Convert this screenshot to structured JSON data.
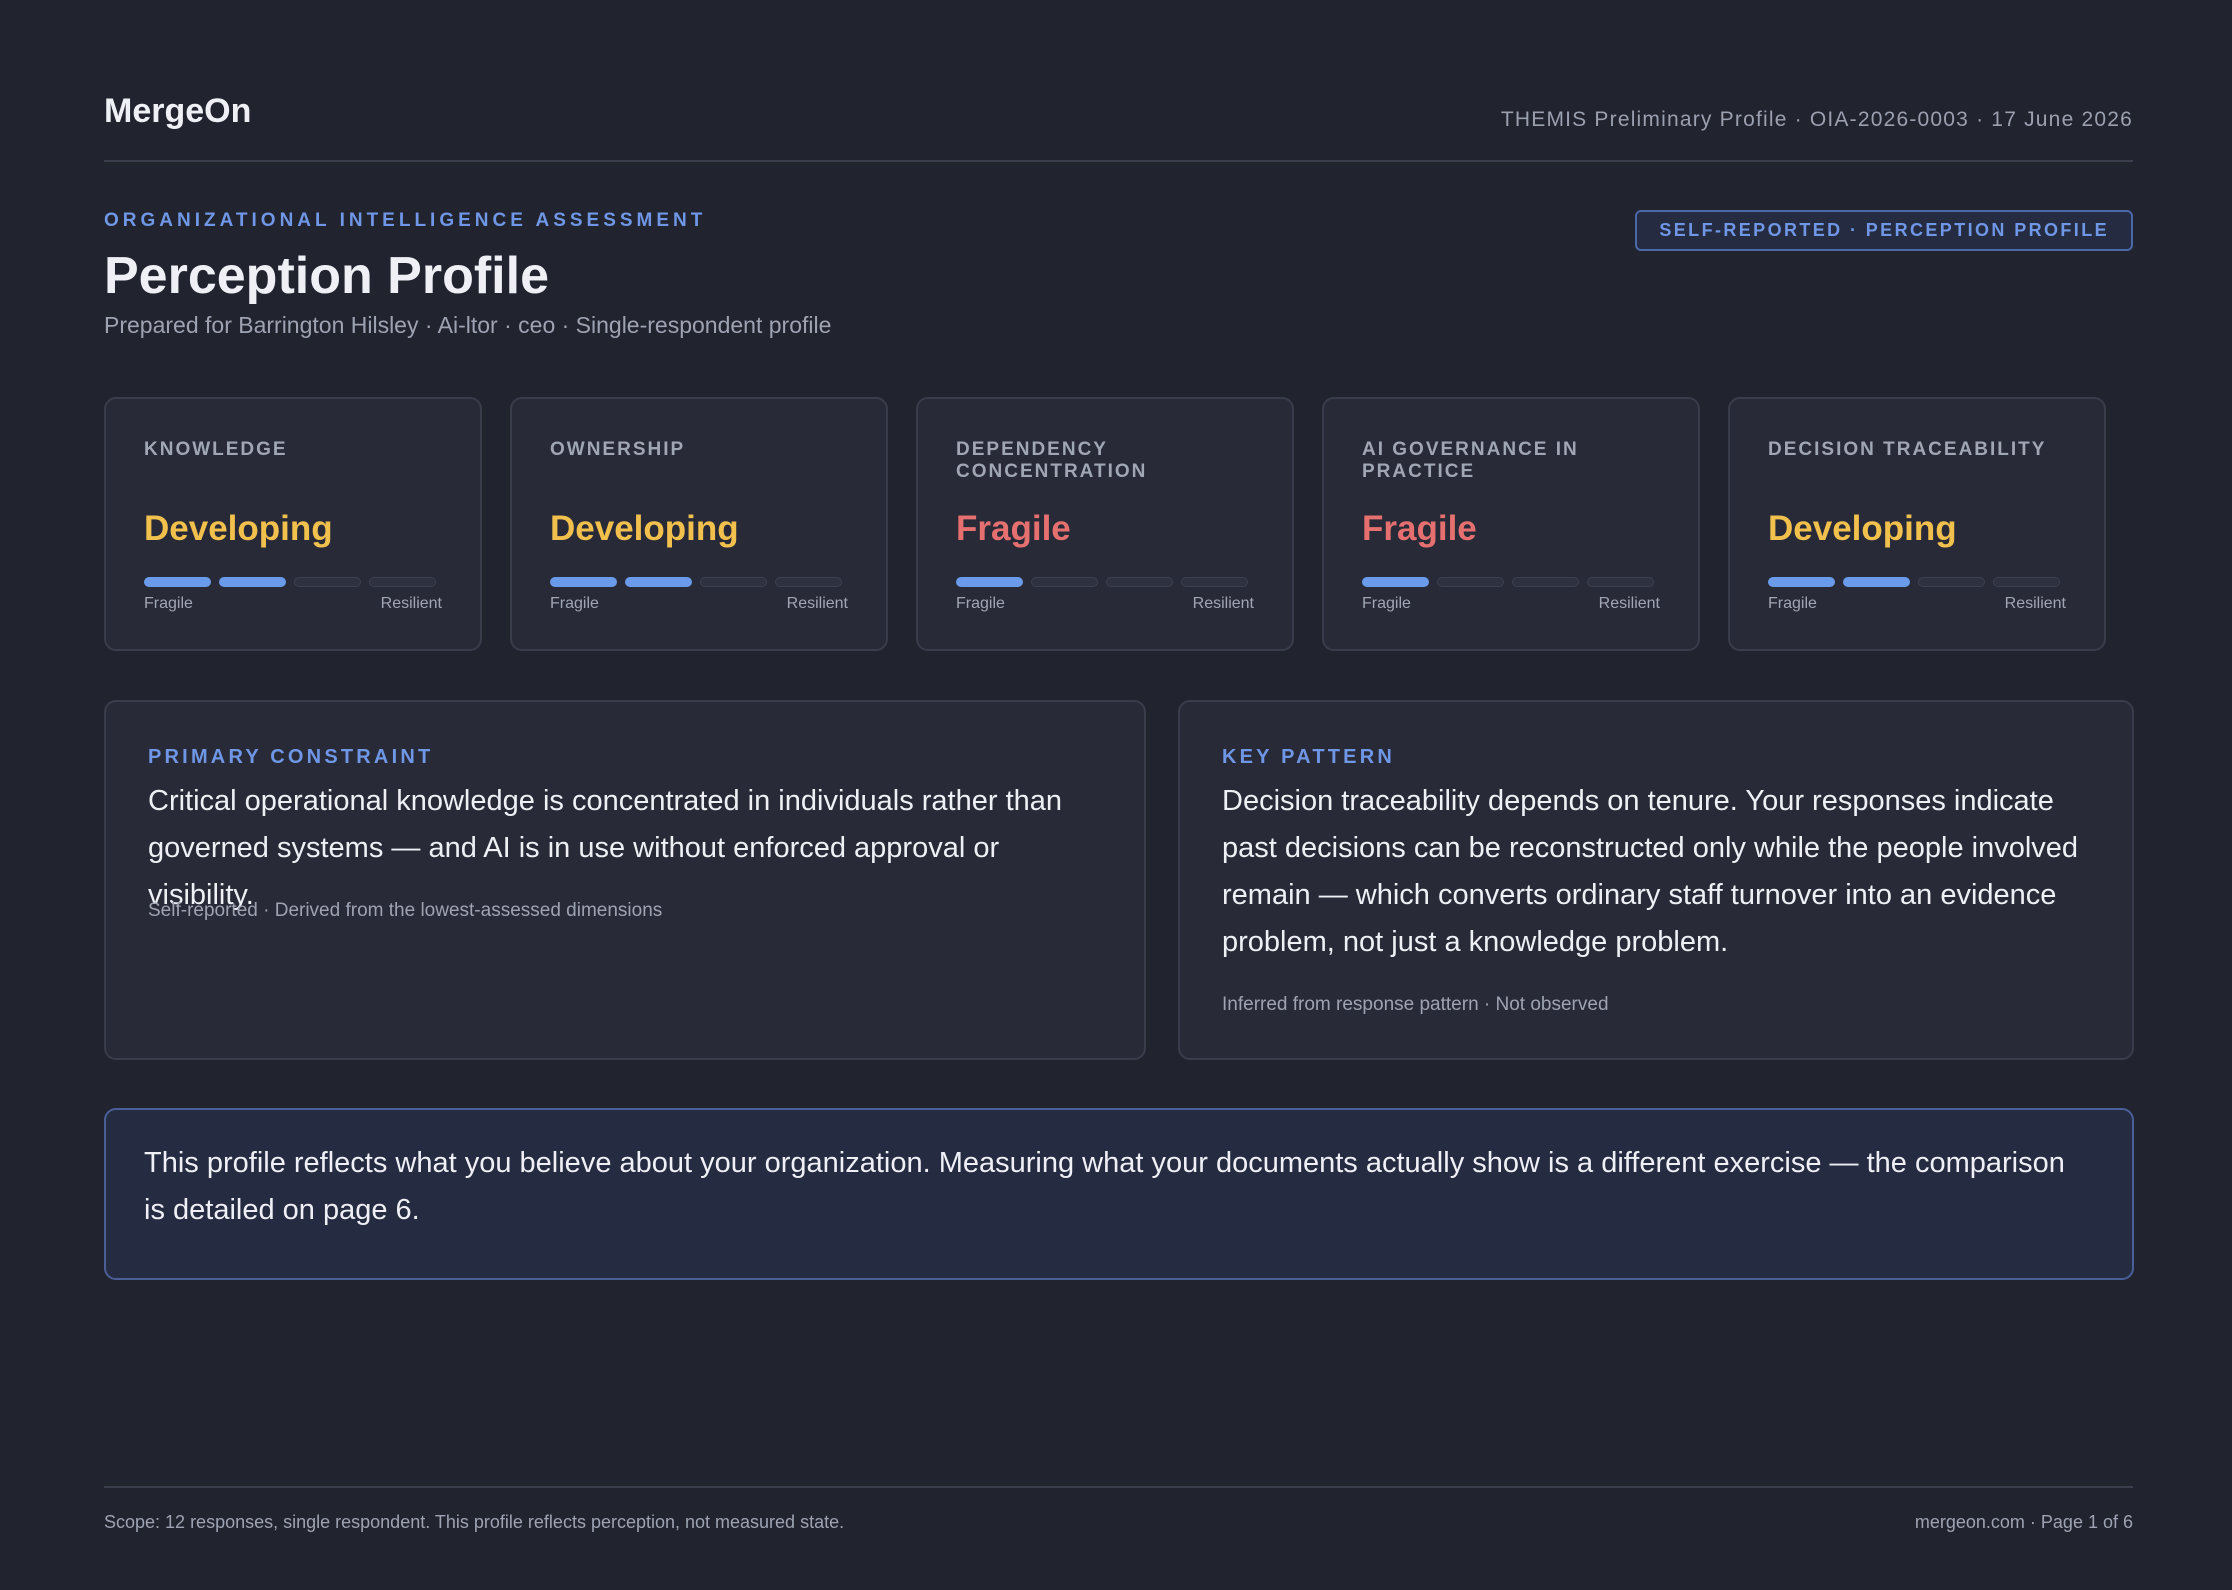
{
  "header": {
    "brand": "MergeOn",
    "meta": "THEMIS Preliminary Profile · OIA-2026-0003 · 17 June 2026"
  },
  "intro": {
    "eyebrow": "ORGANIZATIONAL INTELLIGENCE ASSESSMENT",
    "title": "Perception Profile",
    "subtitle": "Prepared for Barrington Hilsley · Ai-ltor · ceo · Single-respondent profile",
    "badge": "SELF-REPORTED · PERCEPTION PROFILE"
  },
  "colors": {
    "developing": "#f1c04d",
    "fragile": "#e5706f",
    "accent": "#6f97e6",
    "meter_on": "#6a9bea"
  },
  "scale": {
    "low": "Fragile",
    "high": "Resilient",
    "segments": 4
  },
  "dimensions": [
    {
      "label": "KNOWLEDGE",
      "value": "Developing",
      "level": 2
    },
    {
      "label": "OWNERSHIP",
      "value": "Developing",
      "level": 2
    },
    {
      "label": "DEPENDENCY CONCENTRATION",
      "value": "Fragile",
      "level": 1
    },
    {
      "label": "AI GOVERNANCE IN PRACTICE",
      "value": "Fragile",
      "level": 1
    },
    {
      "label": "DECISION TRACEABILITY",
      "value": "Developing",
      "level": 2
    }
  ],
  "primary_constraint": {
    "eyebrow": "PRIMARY CONSTRAINT",
    "body": "Critical operational knowledge is concentrated in individuals rather than governed systems — and AI is in use without enforced approval or visibility.",
    "note": "Self-reported · Derived from the lowest-assessed dimensions"
  },
  "key_pattern": {
    "eyebrow": "KEY PATTERN",
    "body": "Decision traceability depends on tenure. Your responses indicate past decisions can be reconstructed only while the people involved remain — which converts ordinary staff turnover into an evidence problem, not just a knowledge problem.",
    "note": "Inferred from response pattern · Not observed"
  },
  "callout": {
    "text": "This profile reflects what you believe about your organization. Measuring what your documents actually show is a different exercise — the comparison is detailed on page 6."
  },
  "footer": {
    "scope": "Scope: 12 responses, single respondent. This profile reflects perception, not measured state.",
    "page": "mergeon.com · Page 1 of 6"
  }
}
